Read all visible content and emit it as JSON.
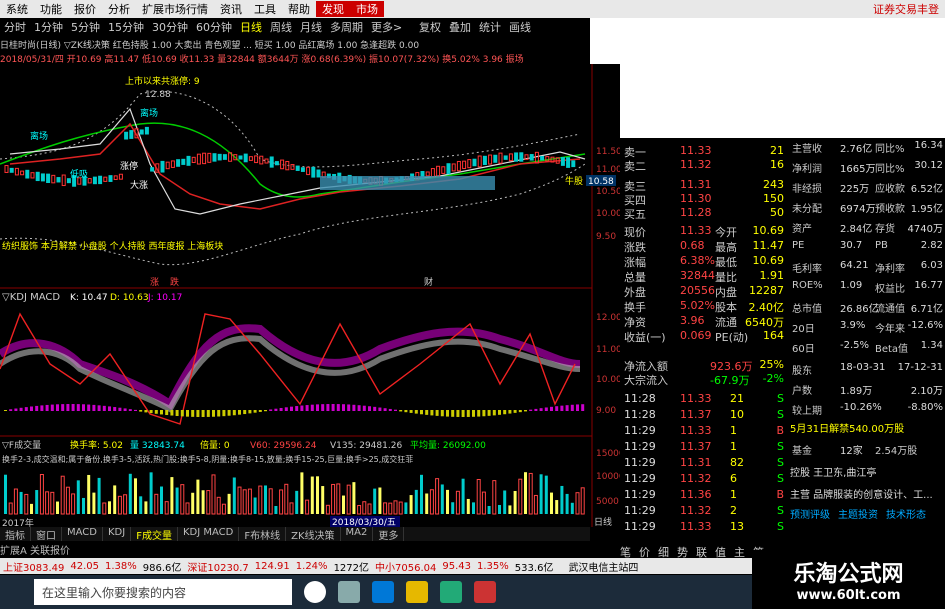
{
  "menu": {
    "items": [
      "系统",
      "功能",
      "报价",
      "分析",
      "扩展市场行情",
      "资讯",
      "工具",
      "帮助"
    ],
    "highlight1": "发现",
    "highlight2": "市场",
    "right_text": "证券交易丰登"
  },
  "periods": {
    "items": [
      "分时",
      "1分钟",
      "5分钟",
      "15分钟",
      "30分钟",
      "60分钟"
    ],
    "active": "日线",
    "rest": [
      "周线",
      "月线",
      "多周期",
      "更多>"
    ]
  },
  "chart_tabs": {
    "items": [
      "复权",
      "叠加",
      "统计",
      "画线"
    ]
  },
  "stock_header": "日桂时尚(日线)  ▽ZK线决策  红色持股  1.00  大卖出  青色观望  ...  短买  1.00  品红离场  1.00  急逢超跌  0.00",
  "info_line": "2018/05/31/四 开10.69 高11.47 低10.69 收11.33 量32844 额3644万 涨0.68(6.39%) 振10.07(7.32%) 换5.02% 3.96 振场",
  "price_labels": {
    "p1": "11.50",
    "p2": "11.00",
    "p3": "10.50",
    "p4": "10.00",
    "p5": "9.50",
    "cur": "10.58"
  },
  "annot": {
    "a1": "上市以来共涨停: 9",
    "a2": "12.88",
    "a3": "离场",
    "a4": "涨停",
    "a5": "大涨",
    "a6": "离场",
    "a7": "低吸",
    "a8": "牛股",
    "a9": "财",
    "a10": "涨",
    "a11": "跌"
  },
  "scroll_text": "纺织服饰 本月解禁 小盘股 个人持股 西年度报 上海板块",
  "kdj": {
    "label": "▽KDJ MACD",
    "k": "K: 10.47",
    "d": "D: 10.63",
    "j": "J: 10.17"
  },
  "kdj_scale": [
    "12.00",
    "11.00",
    "10.00",
    "9.00"
  ],
  "vol": {
    "label": "▽F成交量",
    "v1": "换手率: 5.02",
    "v2": "量 32843.74",
    "v3": "倍量: 0",
    "v4": "V60: 29596.24",
    "v5": "V135: 29481.26",
    "v6": "平均量: 26092.00"
  },
  "vol_note": "换手2-3,成交温和;属于备份,换手3-5,活跃,热门股;换手5-8,阴量;换手8-15,放量;换手15-25,巨量;换手>25,成交狂菲",
  "vol_scale": [
    "15000",
    "10000",
    "5000"
  ],
  "bottom_tabs": [
    "指标",
    "窗口",
    "MACD",
    "KDJ",
    "F成交量",
    "KDJ MACD",
    "F布林线",
    "ZK线决策",
    "MA2",
    "更多"
  ],
  "bottom_active": "F成交量",
  "bottom_dates": {
    "d1": "2017年",
    "d2": "2018/03/30/五",
    "d3": "日线"
  },
  "expand_label": "扩展A  关联报价",
  "quote": {
    "sells": [
      [
        "卖一",
        "11.33",
        "21"
      ],
      [
        "卖二",
        "11.32",
        "16"
      ],
      [
        "卖三",
        "11.31",
        "243"
      ],
      [
        "买四",
        "11.30",
        "150"
      ],
      [
        "买五",
        "11.28",
        "50"
      ]
    ],
    "stats": [
      [
        "现价",
        "11.33",
        "今开",
        "10.69"
      ],
      [
        "涨跌",
        "0.68",
        "最高",
        "11.47"
      ],
      [
        "涨幅",
        "6.38%",
        "最低",
        "10.69"
      ],
      [
        "总量",
        "32844",
        "量比",
        "1.91"
      ],
      [
        "外盘",
        "20556",
        "内盘",
        "12287"
      ],
      [
        "换手",
        "5.02%",
        "股本",
        "2.40亿"
      ],
      [
        "净资",
        "3.96",
        "流通",
        "6540万"
      ],
      [
        "收益(一)",
        "0.069",
        "PE(动)",
        "164"
      ]
    ],
    "flow": [
      [
        "净流入额",
        "923.6万",
        "25%"
      ],
      [
        "大宗流入",
        "-67.9万",
        "-2%"
      ]
    ],
    "ticks": [
      [
        "11:28",
        "11.33",
        "21",
        "S"
      ],
      [
        "11:28",
        "11.37",
        "10",
        "S"
      ],
      [
        "11:29",
        "11.33",
        "1",
        "B"
      ],
      [
        "11:29",
        "11.37",
        "1",
        "S"
      ],
      [
        "11:29",
        "11.31",
        "82",
        "S"
      ],
      [
        "11:29",
        "11.32",
        "6",
        "S"
      ],
      [
        "11:29",
        "11.36",
        "1",
        "B"
      ],
      [
        "11:29",
        "11.32",
        "2",
        "S"
      ],
      [
        "11:29",
        "11.33",
        "13",
        "S"
      ]
    ],
    "tick_tabs": [
      "笔",
      "价",
      "细",
      "势",
      "联",
      "值",
      "主",
      "筹"
    ]
  },
  "fin": {
    "rows": [
      [
        "主营收",
        "2.76亿",
        "同比%",
        "16.34"
      ],
      [
        "净利润",
        "1665万",
        "同比%",
        "30.12"
      ],
      [
        "非经损",
        "225万",
        "应收款",
        "6.52亿"
      ],
      [
        "未分配",
        "6974万",
        "预收款",
        "1.95亿"
      ],
      [
        "资产",
        "2.84亿",
        "存货",
        "4740万"
      ],
      [
        "PE",
        "30.7",
        "PB",
        "2.82"
      ],
      [
        "毛利率",
        "64.21",
        "净利率",
        "6.03"
      ],
      [
        "ROE%",
        "1.09",
        "权益比",
        "16.77"
      ],
      [
        "总市值",
        "26.86亿",
        "流通值",
        "6.71亿"
      ],
      [
        "20日",
        "3.9%",
        "今年来",
        "-12.6%"
      ],
      [
        "60日",
        "-2.5%",
        "Beta值",
        "1.34"
      ],
      [
        "股东",
        "18-03-31",
        "",
        "17-12-31"
      ],
      [
        "户数",
        "1.89万",
        "",
        "2.10万"
      ],
      [
        "较上期",
        "-10.26%",
        "",
        "-8.80%"
      ]
    ],
    "jiejin": "5月31日解禁540.00万股",
    "jijin": [
      "基金",
      "12家",
      "2.54万股"
    ],
    "holder": "控股 王卫东,曲江亭",
    "business": "主营 品牌服装的创意设计、工...",
    "tabs": [
      "预测评级",
      "主题投资",
      "技术形态"
    ]
  },
  "status": {
    "items": [
      "上证3083.49",
      "42.05",
      "1.38%",
      "986.6亿",
      "深证10230.7",
      "124.91",
      "1.24%",
      "1272亿",
      "中小7056.04",
      "95.43",
      "1.35%",
      "533.6亿",
      "武汉电信主站四"
    ]
  },
  "taskbar": {
    "search": "在这里输入你要搜索的内容"
  },
  "watermark": {
    "title": "乐淘公式网",
    "url": "www.60lt.com"
  }
}
